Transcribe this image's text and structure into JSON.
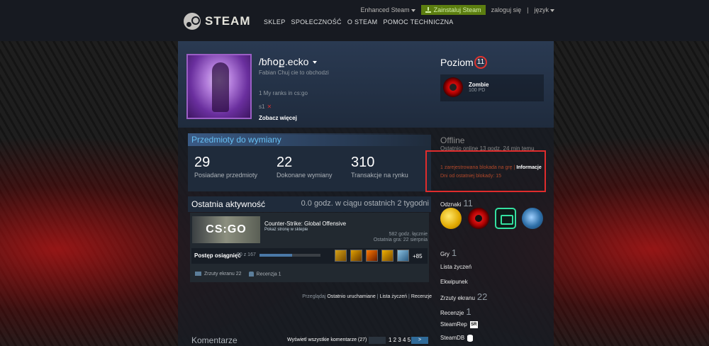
{
  "topbar": {
    "enhanced": "Enhanced Steam",
    "install": "Zainstaluj Steam",
    "login": "zaloguj się",
    "separator": "|",
    "language": "język"
  },
  "header": {
    "logo_text": "STEAM",
    "nav": [
      "SKLEP",
      "SPOŁECZNOŚĆ",
      "O STEAM",
      "POMOC TECHNICZNA"
    ]
  },
  "profile": {
    "name": "/ƅɦօք.ecko",
    "realname": "Fabian Chuj cie to obchodzi",
    "summary": "1 My ranks in cs:go",
    "s1": "s1",
    "x_mark": "✕",
    "more": "Zobacz więcej",
    "level_label": "Poziom",
    "level": "11",
    "fav_badge_name": "Zombie",
    "fav_badge_xp": "100 PD"
  },
  "trade": {
    "title": "Przedmioty do wymiany",
    "stats": [
      {
        "num": "29",
        "label": "Posiadane przedmioty"
      },
      {
        "num": "22",
        "label": "Dokonane wymiany"
      },
      {
        "num": "310",
        "label": "Transakcje na rynku"
      }
    ]
  },
  "activity": {
    "title": "Ostatnia aktywność",
    "hours": "0.0 godz. w ciągu ostatnich 2 tygodni",
    "game_art": "CS:GO",
    "game_name": "Counter-Strike: Global Offensive",
    "game_status": "Pokaż stronę w sklepie",
    "total_hours": "582 godz. łącznie",
    "last_played": "Ostatnia gra: 22 sierpnia",
    "ach_label": "Postęp osiągnięć",
    "ach_count": "90 z 167",
    "ach_fraction": 0.539,
    "ach_more": "+85",
    "screenshots": "Zrzuty ekranu 22",
    "reviews": "Recenzja 1",
    "browse_prefix": "Przeglądaj",
    "browse_recent": "Ostatnio uruchamiane",
    "browse_sep": "|",
    "browse_wishlist": "Lista życzeń",
    "browse_reviews": "Recenzje"
  },
  "comments": {
    "title": "Komentarze",
    "show_all": "Wyświetl wszystkie komentarze (27)",
    "pages": "1 2 3 4 5",
    "next": ">"
  },
  "right": {
    "status": "Offline",
    "since": "Ostatnio online 13 godz. 24 min temu",
    "ban1": "1 zarejestrowana blokada na grę",
    "ban1_sep": "|",
    "ban_info": "Informacje",
    "ban2": "Dni od ostatniej blokady: 15",
    "badges_label": "Odznaki",
    "badges_count": "11",
    "games_label": "Gry",
    "games_count": "1",
    "wishlist": "Lista życzeń",
    "inventory": "Ekwipunek",
    "screens_label": "Zrzuty ekranu",
    "screens_count": "22",
    "reviews_label": "Recenzje",
    "reviews_count": "1",
    "steamrep": "SteamRep",
    "steamrep_icon": "SR",
    "steamdb": "SteamDB"
  }
}
